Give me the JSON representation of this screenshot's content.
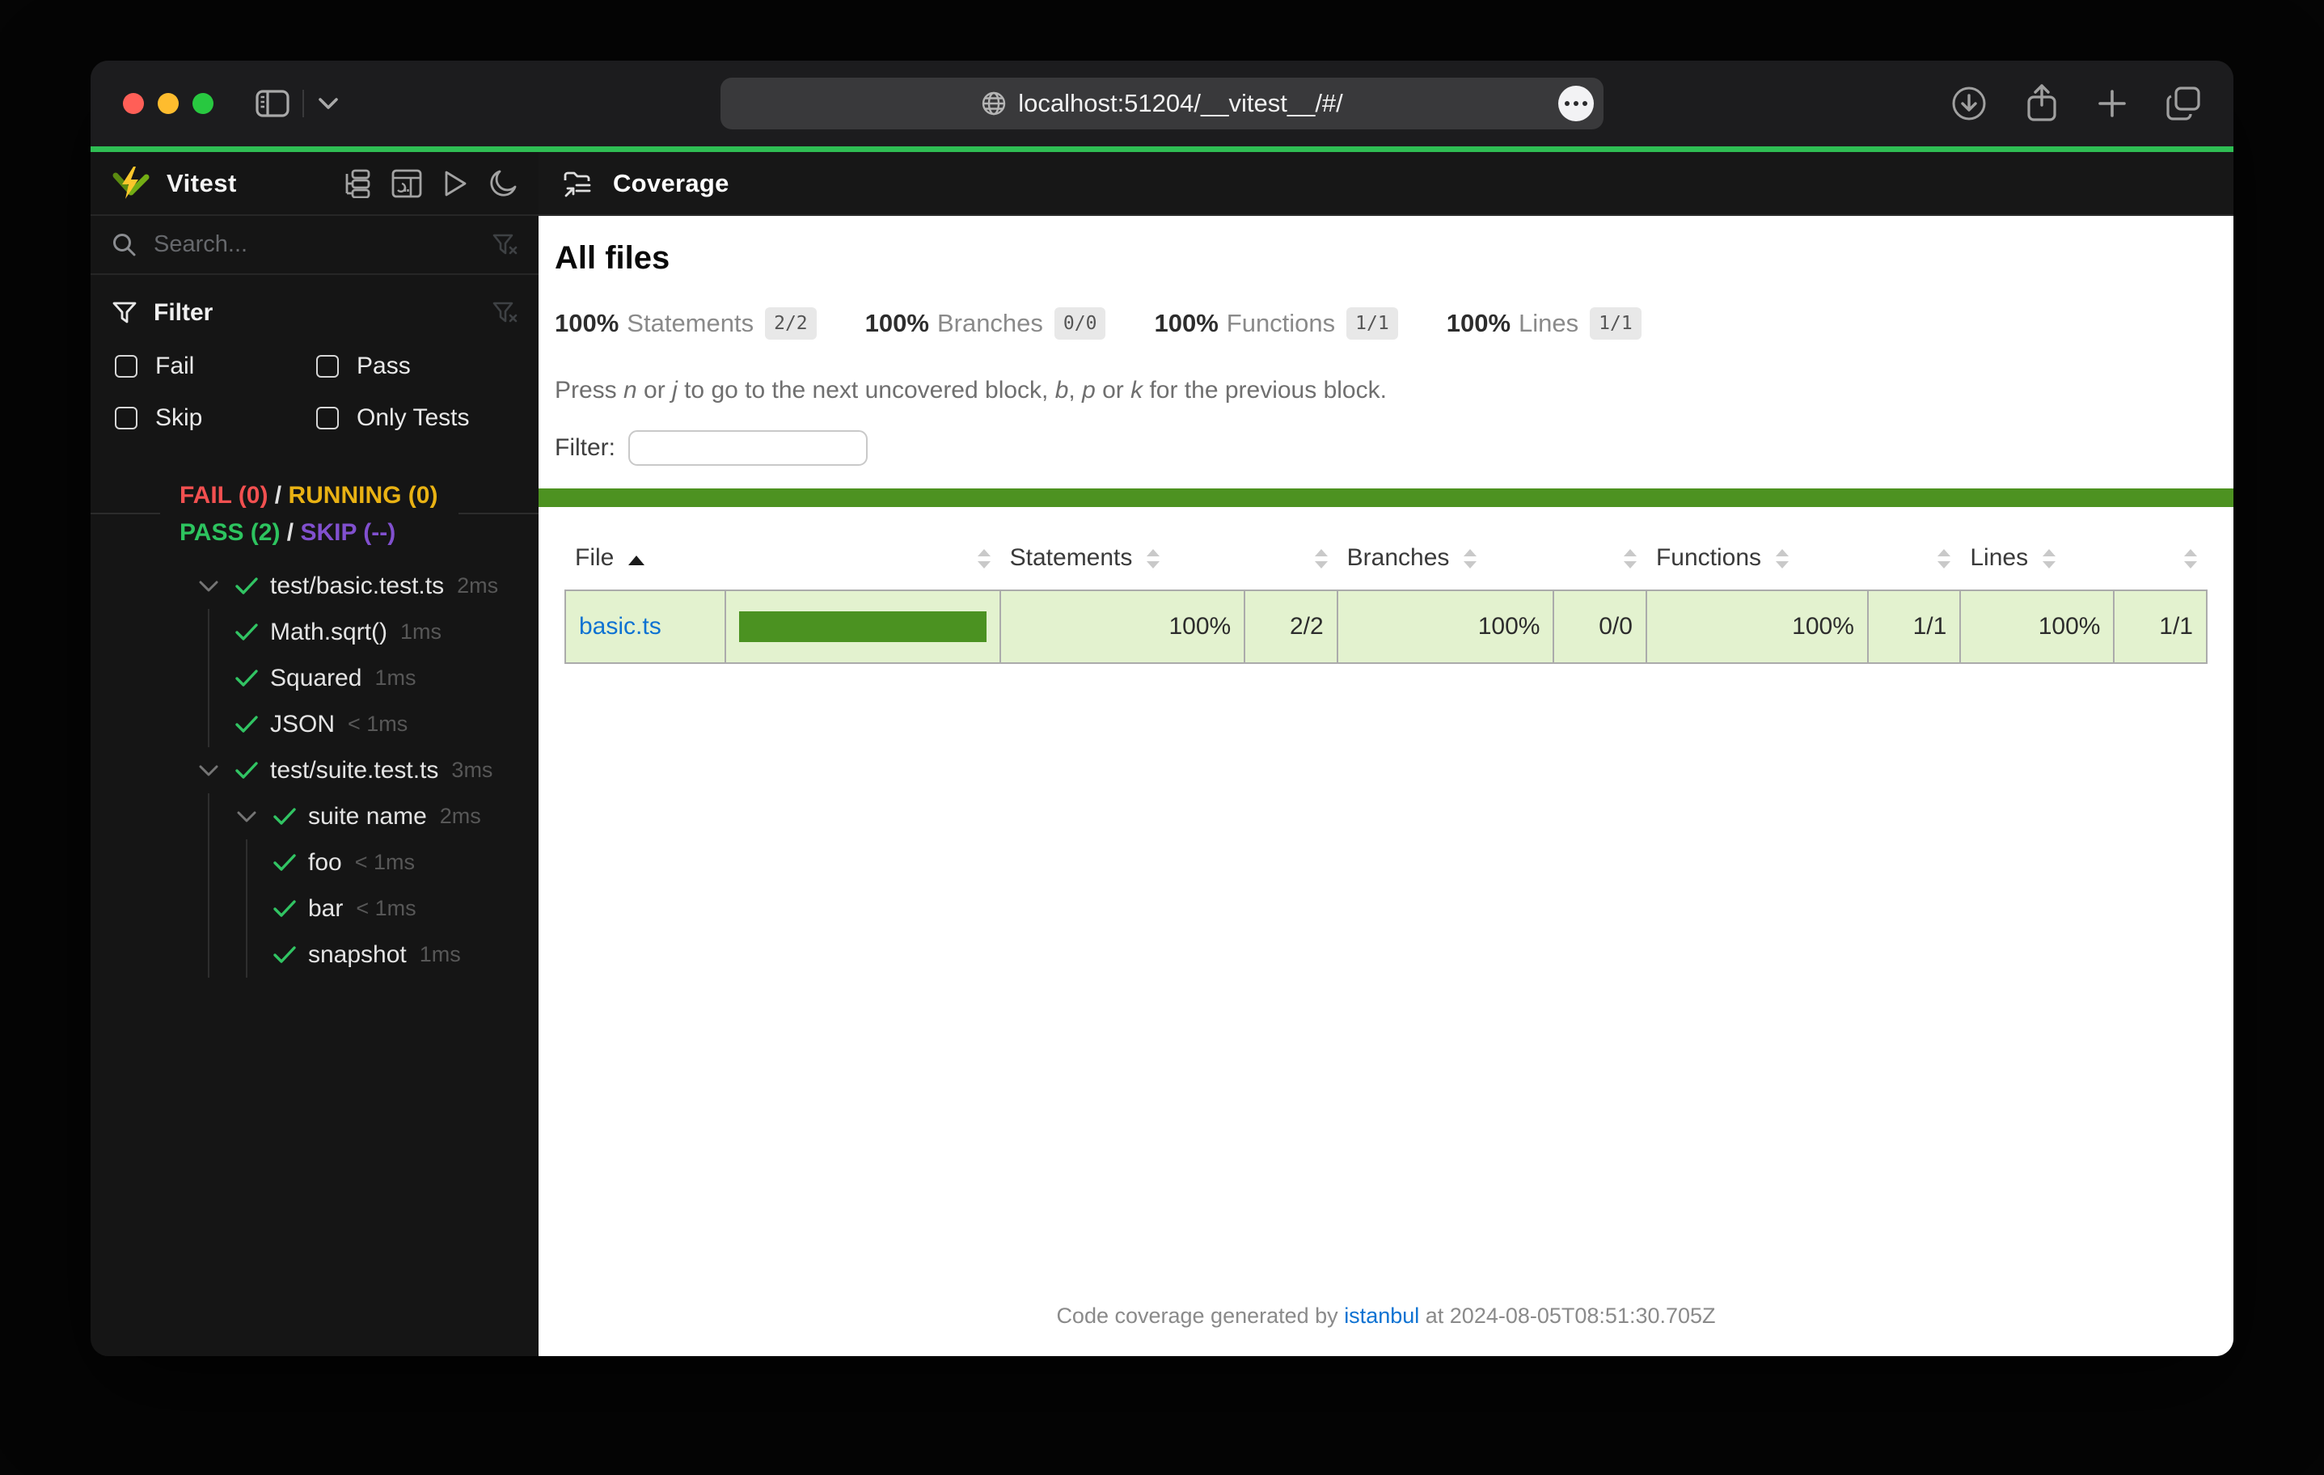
{
  "colors": {
    "accent": "#2fbe54",
    "statusline": "#4d9221",
    "rowbg": "#e3f2cf",
    "bar": "#4b9221",
    "fail": "#f25050",
    "running": "#e9b213",
    "pass": "#2dc45f",
    "skip": "#8150cf",
    "link": "#0d72d2",
    "check": "#31c463"
  },
  "browser": {
    "url": "localhost:51204/__vitest__/#/"
  },
  "sidebar": {
    "app_title": "Vitest",
    "search_placeholder": "Search...",
    "filter": {
      "title": "Filter",
      "options": [
        {
          "label": "Fail"
        },
        {
          "label": "Pass"
        },
        {
          "label": "Skip"
        },
        {
          "label": "Only Tests"
        }
      ]
    },
    "summary": {
      "line1": [
        {
          "t": "FAIL (0)",
          "c": "fail",
          "n": "fail-count"
        },
        {
          "t": " / ",
          "c": "slash"
        },
        {
          "t": "RUNNING (0)",
          "c": "running",
          "n": "running-count"
        }
      ],
      "line2": [
        {
          "t": "PASS (2)",
          "c": "pass",
          "n": "pass-count"
        },
        {
          "t": " / ",
          "c": "slash"
        },
        {
          "t": "SKIP (--)",
          "c": "skip",
          "n": "skip-count"
        }
      ]
    },
    "tree": [
      {
        "label": "test/basic.test.ts",
        "duration": "2ms",
        "level": 0,
        "expandable": true
      },
      {
        "label": "Math.sqrt()",
        "duration": "1ms",
        "level": 1,
        "expandable": false
      },
      {
        "label": "Squared",
        "duration": "1ms",
        "level": 1,
        "expandable": false
      },
      {
        "label": "JSON",
        "duration": "< 1ms",
        "level": 1,
        "expandable": false
      },
      {
        "label": "test/suite.test.ts",
        "duration": "3ms",
        "level": 0,
        "expandable": true
      },
      {
        "label": "suite name",
        "duration": "2ms",
        "level": 1,
        "expandable": true
      },
      {
        "label": "foo",
        "duration": "< 1ms",
        "level": 2,
        "expandable": false
      },
      {
        "label": "bar",
        "duration": "< 1ms",
        "level": 2,
        "expandable": false
      },
      {
        "label": "snapshot",
        "duration": "1ms",
        "level": 2,
        "expandable": false
      }
    ]
  },
  "coverage": {
    "nav_title": "Coverage",
    "heading": "All files",
    "stats": [
      {
        "pct": "100%",
        "label": "Statements",
        "frac": "2/2"
      },
      {
        "pct": "100%",
        "label": "Branches",
        "frac": "0/0"
      },
      {
        "pct": "100%",
        "label": "Functions",
        "frac": "1/1"
      },
      {
        "pct": "100%",
        "label": "Lines",
        "frac": "1/1"
      }
    ],
    "hint": [
      {
        "t": "Press "
      },
      {
        "t": "n",
        "c": "italic"
      },
      {
        "t": " or "
      },
      {
        "t": "j",
        "c": "italic"
      },
      {
        "t": " to go to the next uncovered block, "
      },
      {
        "t": "b",
        "c": "italic"
      },
      {
        "t": ", "
      },
      {
        "t": "p",
        "c": "italic"
      },
      {
        "t": " or "
      },
      {
        "t": "k",
        "c": "italic"
      },
      {
        "t": " for the previous block."
      }
    ],
    "filter_label": "Filter:",
    "table": {
      "col_file": "File",
      "col_statements": "Statements",
      "col_branches": "Branches",
      "col_functions": "Functions",
      "col_lines": "Lines",
      "rows": [
        {
          "file": "basic.ts",
          "bar_pct": "100",
          "stmt_pct": "100%",
          "stmt_frac": "2/2",
          "br_pct": "100%",
          "br_frac": "0/0",
          "fn_pct": "100%",
          "fn_frac": "1/1",
          "ln_pct": "100%",
          "ln_frac": "1/1"
        }
      ]
    },
    "footer": [
      {
        "t": "Code coverage generated by "
      },
      {
        "t": "istanbul",
        "c": "link",
        "n": "istanbul-link",
        "i": true
      },
      {
        "t": " at 2024-08-05T08:51:30.705Z"
      }
    ]
  }
}
